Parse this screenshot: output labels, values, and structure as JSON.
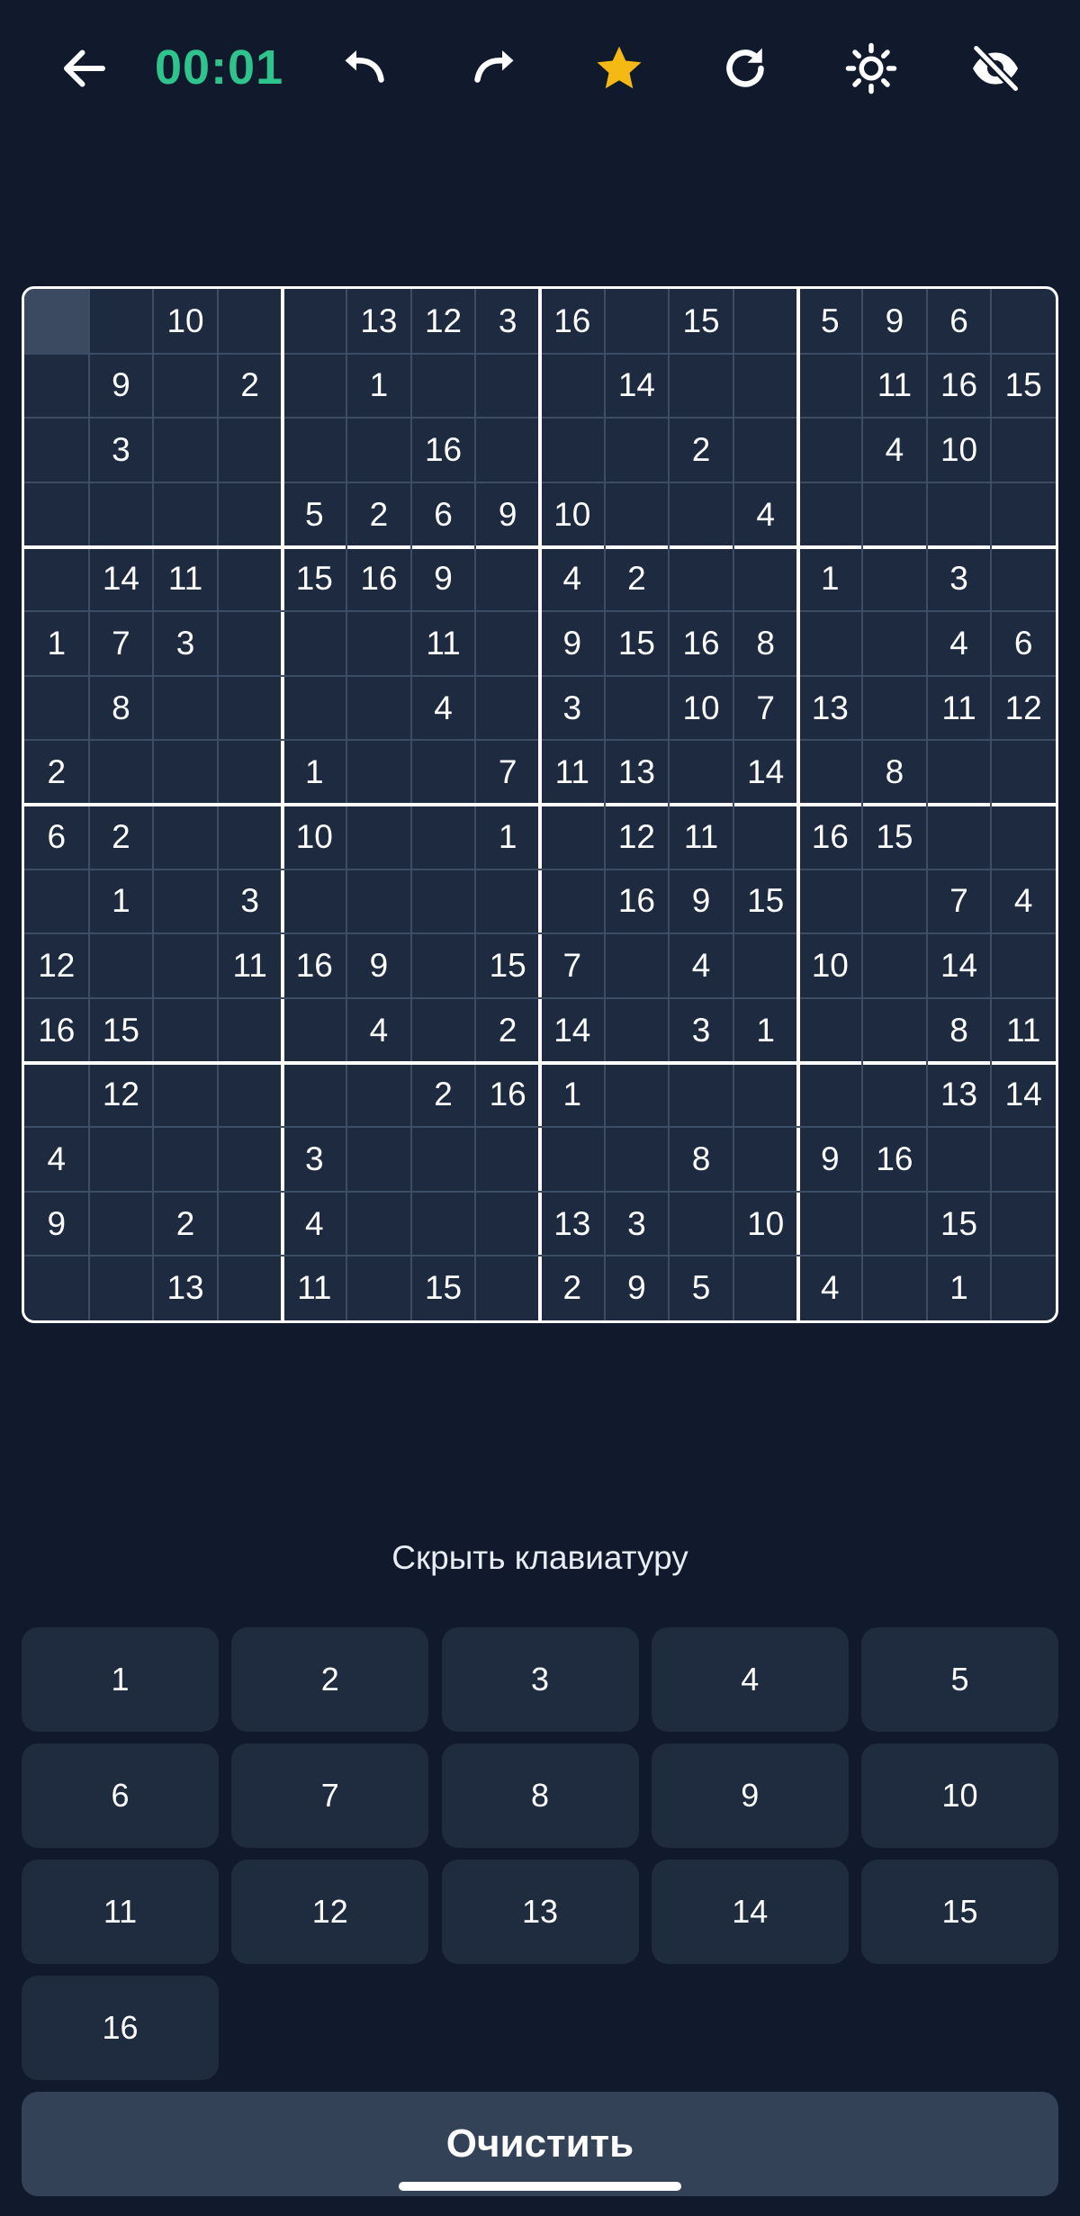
{
  "toolbar": {
    "timer": "00:01",
    "timer_color": "#2fc48d",
    "star_color": "#f5b914",
    "icons": [
      "back-arrow-icon",
      "undo-icon",
      "redo-icon",
      "star-icon",
      "restart-icon",
      "brightness-icon",
      "eye-off-icon"
    ]
  },
  "board": {
    "size": 16,
    "box": 4,
    "selected": [
      0,
      0
    ],
    "grid": [
      [
        "",
        "",
        "10",
        "",
        "",
        "13",
        "12",
        "3",
        "16",
        "",
        "15",
        "",
        "5",
        "9",
        "6",
        ""
      ],
      [
        "",
        "9",
        "",
        "2",
        "",
        "1",
        "",
        "",
        "",
        "14",
        "",
        "",
        "",
        "11",
        "16",
        "15"
      ],
      [
        "",
        "3",
        "",
        "",
        "",
        "",
        "16",
        "",
        "",
        "",
        "2",
        "",
        "",
        "4",
        "10",
        ""
      ],
      [
        "",
        "",
        "",
        "",
        "5",
        "2",
        "6",
        "9",
        "10",
        "",
        "",
        "4",
        "",
        "",
        "",
        ""
      ],
      [
        "",
        "14",
        "11",
        "",
        "15",
        "16",
        "9",
        "",
        "4",
        "2",
        "",
        "",
        "1",
        "",
        "3",
        ""
      ],
      [
        "1",
        "7",
        "3",
        "",
        "",
        "",
        "11",
        "",
        "9",
        "15",
        "16",
        "8",
        "",
        "",
        "4",
        "6"
      ],
      [
        "",
        "8",
        "",
        "",
        "",
        "",
        "4",
        "",
        "3",
        "",
        "10",
        "7",
        "13",
        "",
        "11",
        "12"
      ],
      [
        "2",
        "",
        "",
        "",
        "1",
        "",
        "",
        "7",
        "11",
        "13",
        "",
        "14",
        "",
        "8",
        "",
        ""
      ],
      [
        "6",
        "2",
        "",
        "",
        "10",
        "",
        "",
        "1",
        "",
        "12",
        "11",
        "",
        "16",
        "15",
        "",
        ""
      ],
      [
        "",
        "1",
        "",
        "3",
        "",
        "",
        "",
        "",
        "",
        "16",
        "9",
        "15",
        "",
        "",
        "7",
        "4"
      ],
      [
        "12",
        "",
        "",
        "11",
        "16",
        "9",
        "",
        "15",
        "7",
        "",
        "4",
        "",
        "10",
        "",
        "14",
        ""
      ],
      [
        "16",
        "15",
        "",
        "",
        "",
        "4",
        "",
        "2",
        "14",
        "",
        "3",
        "1",
        "",
        "",
        "8",
        "11"
      ],
      [
        "",
        "12",
        "",
        "",
        "",
        "",
        "2",
        "16",
        "1",
        "",
        "",
        "",
        "",
        "",
        "13",
        "14"
      ],
      [
        "4",
        "",
        "",
        "",
        "3",
        "",
        "",
        "",
        "",
        "",
        "8",
        "",
        "9",
        "16",
        "",
        ""
      ],
      [
        "9",
        "",
        "2",
        "",
        "4",
        "",
        "",
        "",
        "13",
        "3",
        "",
        "10",
        "",
        "",
        "15",
        ""
      ],
      [
        "",
        "",
        "13",
        "",
        "11",
        "",
        "15",
        "",
        "2",
        "9",
        "5",
        "",
        "4",
        "",
        "1",
        ""
      ]
    ]
  },
  "keyboard": {
    "hide_label": "Скрыть клавиатуру",
    "keys": [
      "1",
      "2",
      "3",
      "4",
      "5",
      "6",
      "7",
      "8",
      "9",
      "10",
      "11",
      "12",
      "13",
      "14",
      "15",
      "16"
    ],
    "clear_label": "Очистить"
  }
}
